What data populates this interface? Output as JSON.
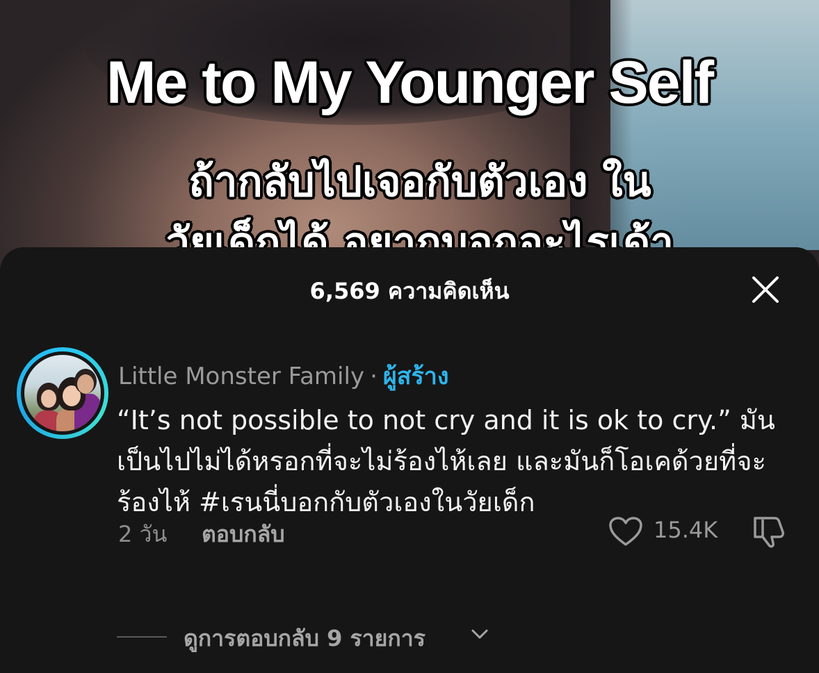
{
  "video": {
    "title": "Me to My Younger Self",
    "subtitle_line1": "ถ้ากลับไปเจอกับตัวเอง ใน",
    "subtitle_line2": "วัยเด็กได้ อยากบอกอะไรเด้า"
  },
  "comments_sheet": {
    "header": "6,569 ความคิดเห็น",
    "close_icon": "close-icon",
    "comment": {
      "author": "Little Monster Family",
      "separator": "·",
      "creator_tag": "ผู้สร้าง",
      "text": "“It’s not possible to not cry and it is ok to cry.” มันเป็นไปไม่ได้หรอกที่จะไม่ร้องไห้เลย และมันก็โอเคด้วยที่จะร้องไห้ #เรนนี่บอกกับตัวเองในวัยเด็ก",
      "time": "2 วัน",
      "reply_label": "ตอบกลับ",
      "like_icon": "heart-icon",
      "like_count": "15.4K",
      "dislike_icon": "thumbs-down-icon"
    },
    "view_replies": {
      "label": "ดูการตอบกลับ 9 รายการ",
      "icon": "chevron-down-icon"
    }
  },
  "colors": {
    "background": "#161616",
    "creator_accent": "#2fb4ea",
    "avatar_ring": "#27c4f5"
  }
}
